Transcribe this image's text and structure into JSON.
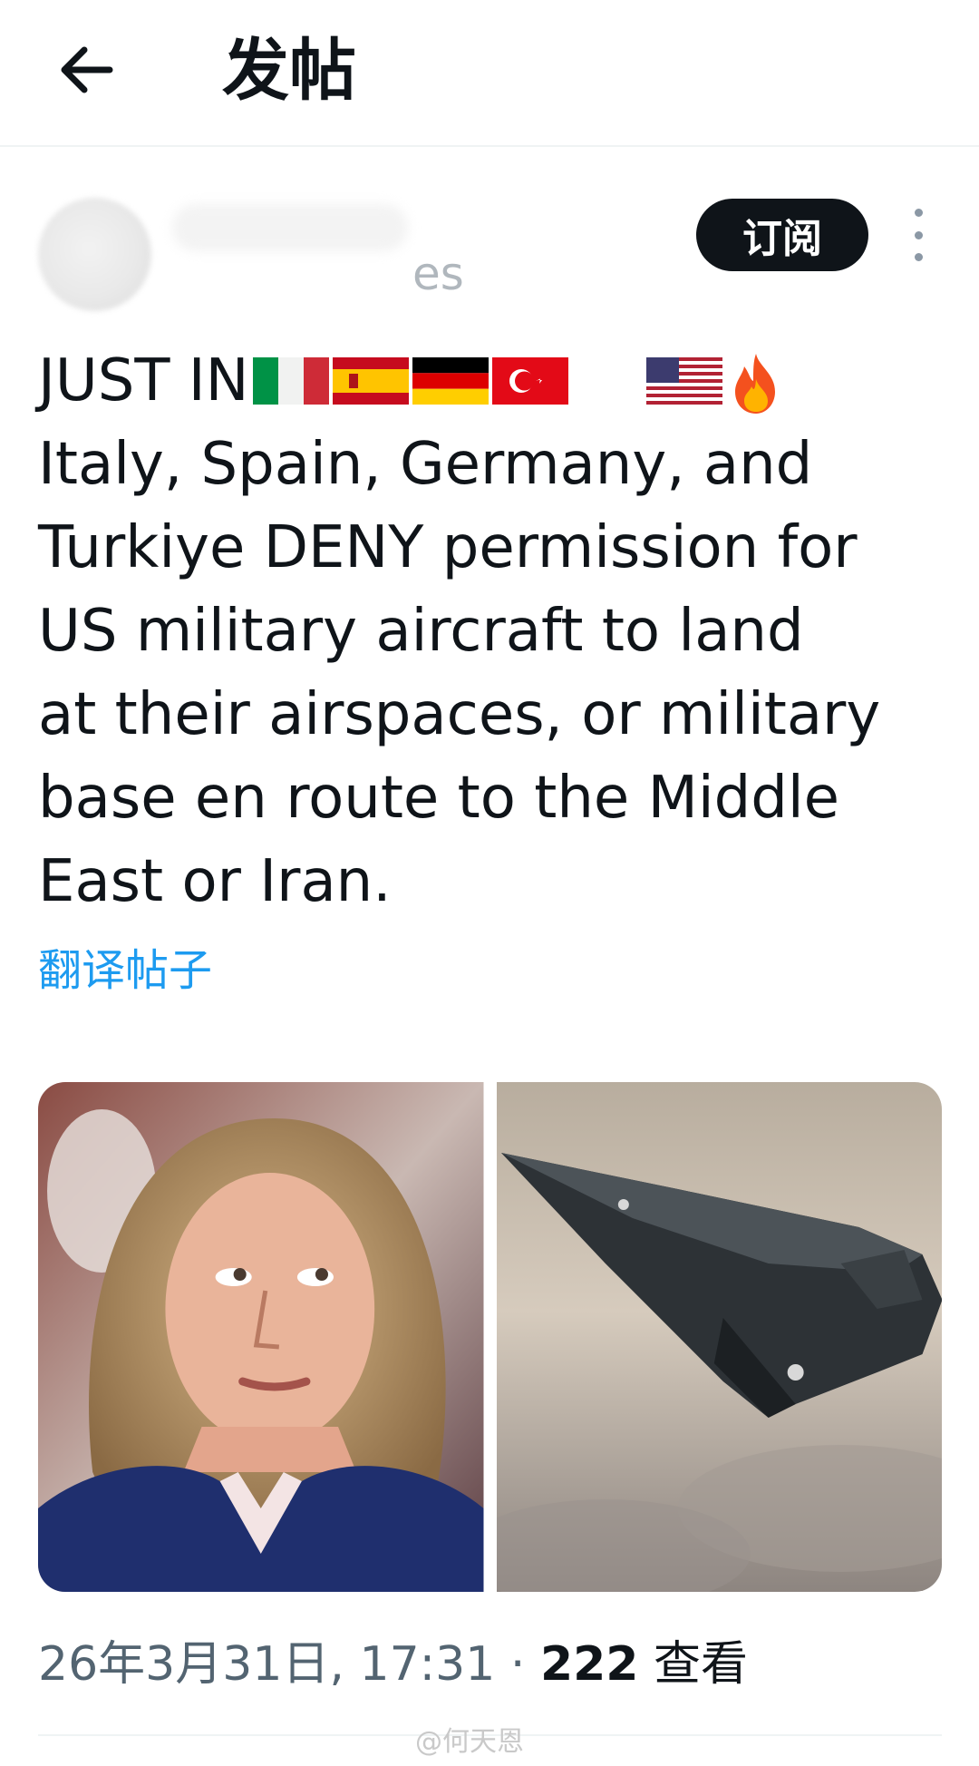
{
  "header": {
    "title": "发帖"
  },
  "author": {
    "handle_fragment": "es"
  },
  "actions": {
    "subscribe_label": "订阅"
  },
  "post": {
    "headline_text": "JUST IN",
    "headline_emojis": [
      "flag-italy",
      "flag-spain",
      "flag-germany",
      "flag-turkey",
      "flag-usa",
      "fire"
    ],
    "lines": [
      "Italy, Spain, Germany, and",
      "Turkiye DENY permission for",
      "US military aircraft to land",
      "at their airspaces, or military",
      "base en route to the Middle",
      "East or Iran."
    ],
    "translate_label": "翻译帖子"
  },
  "media": {
    "images": [
      "portrait-photo",
      "stealth-aircraft-photo"
    ]
  },
  "meta": {
    "timestamp": "26年3月31日, 17:31",
    "separator": "·",
    "views_count": "222",
    "views_label": "查看"
  },
  "watermark": "@何天恩",
  "colors": {
    "link": "#1d9bf0",
    "text": "#0f1419",
    "secondary": "#536471",
    "button_bg": "#0f1419"
  }
}
